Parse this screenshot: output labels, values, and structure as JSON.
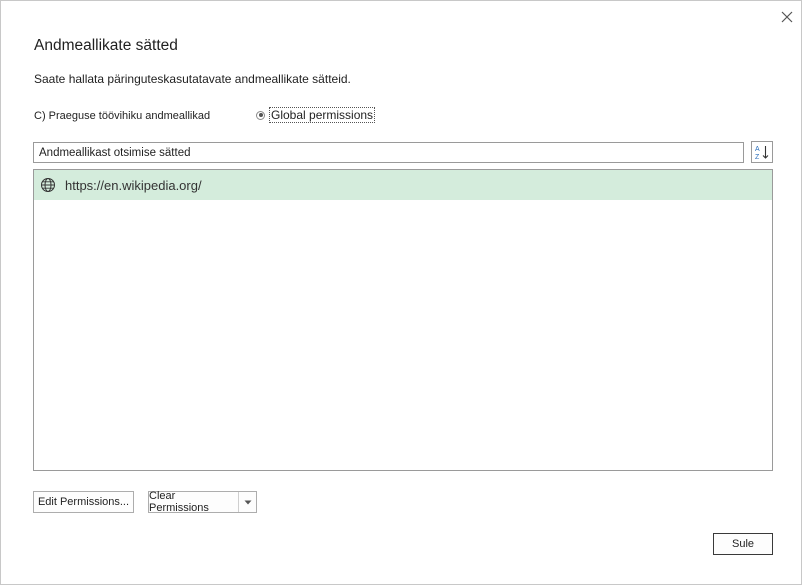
{
  "dialog": {
    "title": "Andmeallikate sätted",
    "subtitle": "Saate hallata päringuteskasutatavate andmeallikate sätteid.",
    "close_icon": "close-icon"
  },
  "scope": {
    "current_label": "C) Praeguse töövihiku andmeallikad",
    "global_label": "Global permissions",
    "selected": "global"
  },
  "search": {
    "placeholder": "Andmeallikast otsimise sätted",
    "value": ""
  },
  "sort": {
    "icon": "sort-az-icon"
  },
  "sources": [
    {
      "url": "https://en.wikipedia.org/",
      "icon": "globe-icon",
      "selected": true
    }
  ],
  "buttons": {
    "edit_label": "Edit Permissions...",
    "clear_label": "Clear Permissions",
    "close_label": "Sule"
  },
  "colors": {
    "selected_row": "#d4ecdc",
    "border": "#9a9a9a"
  }
}
